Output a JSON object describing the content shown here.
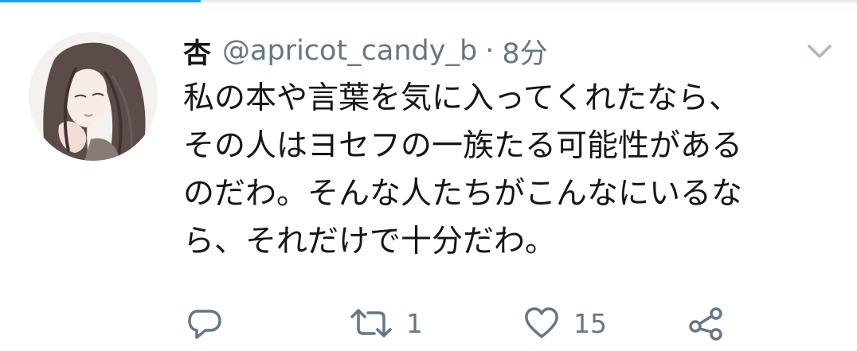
{
  "tweet": {
    "display_name": "杏",
    "handle": "@apricot_candy_b",
    "separator": "·",
    "time": "8分",
    "text_lines": [
      "私の本や言葉を気に入ってくれたなら、",
      "その人はヨセフの一族たる可能性がある",
      "のだわ。そんな人たちがこんなにいるな",
      "ら、それだけで十分だわ。"
    ]
  },
  "actions": {
    "reply": {
      "icon": "reply-icon"
    },
    "retweet": {
      "icon": "retweet-icon",
      "count": "1"
    },
    "like": {
      "icon": "heart-icon",
      "count": "15"
    },
    "share": {
      "icon": "share-icon"
    }
  },
  "colors": {
    "accent": "#1da1f2",
    "secondary_text": "#657786",
    "primary_text": "#14171a"
  }
}
